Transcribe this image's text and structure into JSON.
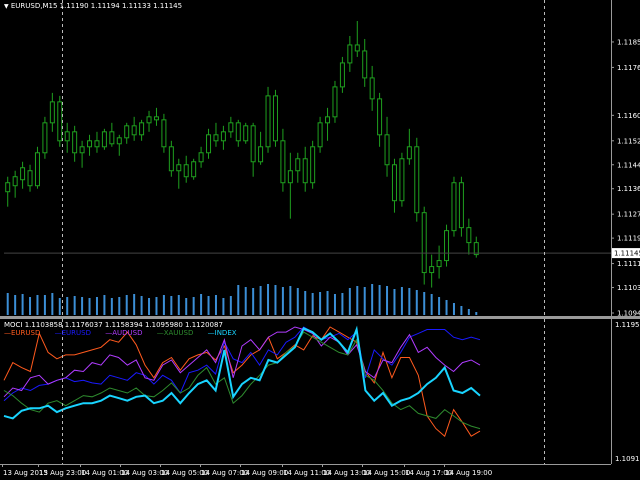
{
  "header": {
    "symbol_menu_icon": "triangle-down-icon",
    "symbol_line": "EURUSD,M15  1.11190 1.11194 1.11133 1.11145"
  },
  "price_axis": {
    "labels": [
      "1.11850",
      "1.11765",
      "1.11605",
      "1.11520",
      "1.11440",
      "1.11360",
      "1.11275",
      "1.11195",
      "1.11110",
      "1.11030",
      "1.10945"
    ],
    "current_price": "1.11145"
  },
  "oscillator": {
    "header_line": "MOCI 1.1103858 1.1176037 1.1158394 1.1095980 1.1120087",
    "legend": [
      {
        "name": "EURUSD",
        "color": "#ff5a1e"
      },
      {
        "name": "EURUSD",
        "color": "#1a1aff"
      },
      {
        "name": "AUDUSD",
        "color": "#b03cff"
      },
      {
        "name": "XAUUSD",
        "color": "#2e8b2e"
      },
      {
        "name": "INDEX",
        "color": "#19d4ff"
      }
    ],
    "axis_top": "1.1195774",
    "axis_bottom": "1.1091229"
  },
  "time_axis": {
    "labels": [
      "13 Aug 2015",
      "13 Aug 23:00",
      "14 Aug 01:00",
      "14 Aug 03:00",
      "14 Aug 05:00",
      "14 Aug 07:00",
      "14 Aug 09:00",
      "14 Aug 11:00",
      "14 Aug 13:00",
      "14 Aug 15:00",
      "14 Aug 17:00",
      "14 Aug 19:00"
    ]
  },
  "chart_data": {
    "type": "candlestick",
    "y_min": 1.10945,
    "y_max": 1.1193,
    "candles": [
      [
        1.1135,
        1.114,
        1.113,
        1.1138
      ],
      [
        1.1137,
        1.1142,
        1.1133,
        1.114
      ],
      [
        1.1139,
        1.1145,
        1.1136,
        1.1143
      ],
      [
        1.1142,
        1.1144,
        1.1135,
        1.1137
      ],
      [
        1.1137,
        1.115,
        1.1136,
        1.1148
      ],
      [
        1.1148,
        1.116,
        1.1146,
        1.1158
      ],
      [
        1.1158,
        1.1168,
        1.1155,
        1.1165
      ],
      [
        1.1165,
        1.1167,
        1.115,
        1.1152
      ],
      [
        1.1152,
        1.1158,
        1.1148,
        1.1155
      ],
      [
        1.1155,
        1.1157,
        1.1145,
        1.1148
      ],
      [
        1.1148,
        1.1152,
        1.1143,
        1.115
      ],
      [
        1.115,
        1.1154,
        1.1147,
        1.1152
      ],
      [
        1.1152,
        1.1155,
        1.1148,
        1.115
      ],
      [
        1.115,
        1.1156,
        1.1149,
        1.1155
      ],
      [
        1.1155,
        1.1158,
        1.115,
        1.1151
      ],
      [
        1.1151,
        1.1154,
        1.1147,
        1.1153
      ],
      [
        1.1153,
        1.1158,
        1.1151,
        1.1157
      ],
      [
        1.1157,
        1.116,
        1.1152,
        1.1154
      ],
      [
        1.1154,
        1.1159,
        1.1152,
        1.1158
      ],
      [
        1.1158,
        1.1162,
        1.1155,
        1.116
      ],
      [
        1.116,
        1.1163,
        1.1157,
        1.1159
      ],
      [
        1.1159,
        1.1161,
        1.1148,
        1.115
      ],
      [
        1.115,
        1.1152,
        1.114,
        1.1142
      ],
      [
        1.1142,
        1.1146,
        1.1136,
        1.1144
      ],
      [
        1.1144,
        1.1147,
        1.1138,
        1.114
      ],
      [
        1.114,
        1.1146,
        1.1139,
        1.1145
      ],
      [
        1.1145,
        1.115,
        1.1143,
        1.1148
      ],
      [
        1.1148,
        1.1156,
        1.1146,
        1.1154
      ],
      [
        1.1154,
        1.1158,
        1.115,
        1.1152
      ],
      [
        1.1152,
        1.1157,
        1.1149,
        1.1155
      ],
      [
        1.1155,
        1.116,
        1.1153,
        1.1158
      ],
      [
        1.1158,
        1.1159,
        1.115,
        1.1152
      ],
      [
        1.1152,
        1.1158,
        1.1151,
        1.1157
      ],
      [
        1.1157,
        1.1158,
        1.114,
        1.1145
      ],
      [
        1.1145,
        1.1155,
        1.1144,
        1.115
      ],
      [
        1.115,
        1.117,
        1.1148,
        1.1167
      ],
      [
        1.1167,
        1.1169,
        1.115,
        1.1152
      ],
      [
        1.1152,
        1.1156,
        1.1135,
        1.1138
      ],
      [
        1.1138,
        1.1148,
        1.1126,
        1.1142
      ],
      [
        1.1142,
        1.1148,
        1.1138,
        1.1146
      ],
      [
        1.1146,
        1.115,
        1.1135,
        1.1138
      ],
      [
        1.1138,
        1.1152,
        1.1136,
        1.115
      ],
      [
        1.115,
        1.116,
        1.1148,
        1.1158
      ],
      [
        1.1158,
        1.1163,
        1.1152,
        1.116
      ],
      [
        1.116,
        1.1172,
        1.1158,
        1.117
      ],
      [
        1.117,
        1.118,
        1.1168,
        1.1178
      ],
      [
        1.1178,
        1.1187,
        1.1175,
        1.1184
      ],
      [
        1.1184,
        1.1192,
        1.118,
        1.1182
      ],
      [
        1.1182,
        1.1186,
        1.117,
        1.1173
      ],
      [
        1.1173,
        1.1177,
        1.1162,
        1.1166
      ],
      [
        1.1166,
        1.1168,
        1.115,
        1.1154
      ],
      [
        1.1154,
        1.116,
        1.114,
        1.1144
      ],
      [
        1.1144,
        1.1146,
        1.1128,
        1.1132
      ],
      [
        1.1132,
        1.1148,
        1.113,
        1.1146
      ],
      [
        1.1146,
        1.1156,
        1.1144,
        1.115
      ],
      [
        1.115,
        1.1153,
        1.1125,
        1.1128
      ],
      [
        1.1128,
        1.113,
        1.1104,
        1.1108
      ],
      [
        1.1108,
        1.1114,
        1.1103,
        1.111
      ],
      [
        1.111,
        1.1117,
        1.1106,
        1.1112
      ],
      [
        1.1112,
        1.1124,
        1.111,
        1.1122
      ],
      [
        1.1122,
        1.114,
        1.112,
        1.1138
      ],
      [
        1.1138,
        1.114,
        1.112,
        1.1123
      ],
      [
        1.1123,
        1.1126,
        1.1114,
        1.1118
      ],
      [
        1.1118,
        1.112,
        1.1113,
        1.1114
      ]
    ],
    "volume": [
      22,
      20,
      21,
      18,
      20,
      20,
      22,
      17,
      18,
      19,
      18,
      17,
      18,
      20,
      17,
      18,
      20,
      21,
      19,
      17,
      18,
      20,
      19,
      20,
      17,
      18,
      21,
      19,
      20,
      17,
      19,
      30,
      28,
      27,
      29,
      31,
      30,
      28,
      29,
      27,
      24,
      22,
      23,
      24,
      21,
      22,
      27,
      29,
      28,
      31,
      30,
      29,
      26,
      28,
      27,
      25,
      23,
      21,
      18,
      15,
      12,
      9,
      6,
      3
    ],
    "series": [
      {
        "name": "EURUSD",
        "color": "#ff5a1e",
        "values": [
          58,
          72,
          68,
          65,
          95,
          80,
          75,
          78,
          78,
          80,
          82,
          84,
          90,
          88,
          96,
          86,
          70,
          60,
          72,
          76,
          66,
          75,
          78,
          80,
          74,
          85,
          64,
          70,
          78,
          82,
          92,
          75,
          80,
          86,
          82,
          93,
          90,
          100,
          96,
          92,
          88,
          65,
          56,
          80,
          60,
          76,
          76,
          62,
          30,
          20,
          14,
          35,
          25,
          14,
          18
        ]
      },
      {
        "name": "EURUSD",
        "color": "#1a1aff",
        "values": [
          42,
          48,
          52,
          50,
          54,
          55,
          58,
          60,
          57,
          58,
          56,
          55,
          62,
          60,
          58,
          64,
          62,
          55,
          62,
          58,
          48,
          64,
          66,
          70,
          63,
          88,
          75,
          72,
          80,
          70,
          82,
          78,
          88,
          92,
          100,
          96,
          90,
          92,
          95,
          90,
          96,
          60,
          82,
          75,
          70,
          80,
          92,
          95,
          98,
          98,
          98,
          92,
          90,
          92,
          90
        ]
      },
      {
        "name": "AUDUSD",
        "color": "#b03cff",
        "values": [
          45,
          52,
          50,
          60,
          62,
          55,
          58,
          60,
          66,
          65,
          72,
          70,
          78,
          76,
          70,
          74,
          60,
          58,
          70,
          74,
          64,
          70,
          76,
          82,
          72,
          90,
          60,
          85,
          90,
          82,
          92,
          96,
          96,
          100,
          98,
          95,
          85,
          92,
          88,
          78,
          86,
          65,
          60,
          74,
          72,
          84,
          94,
          80,
          84,
          76,
          70,
          65,
          72,
          74,
          70
        ]
      },
      {
        "name": "XAUUSD",
        "color": "#2e8b2e",
        "values": [
          50,
          46,
          40,
          35,
          33,
          40,
          42,
          38,
          42,
          46,
          45,
          48,
          52,
          50,
          48,
          52,
          46,
          45,
          50,
          56,
          48,
          52,
          62,
          68,
          55,
          60,
          40,
          46,
          55,
          62,
          70,
          72,
          80,
          85,
          96,
          92,
          88,
          84,
          80,
          78,
          90,
          62,
          58,
          50,
          40,
          35,
          38,
          32,
          30,
          28,
          35,
          30,
          25,
          22,
          20
        ]
      },
      {
        "name": "INDEX",
        "color": "#19d4ff",
        "values": [
          30,
          28,
          34,
          36,
          36,
          38,
          33,
          36,
          38,
          40,
          40,
          42,
          46,
          44,
          42,
          45,
          46,
          40,
          42,
          48,
          40,
          48,
          55,
          58,
          50,
          82,
          45,
          55,
          60,
          58,
          74,
          72,
          78,
          84,
          99,
          96,
          90,
          95,
          88,
          80,
          98,
          50,
          42,
          48,
          38,
          42,
          44,
          48,
          55,
          60,
          68,
          50,
          48,
          52,
          46
        ]
      }
    ]
  }
}
